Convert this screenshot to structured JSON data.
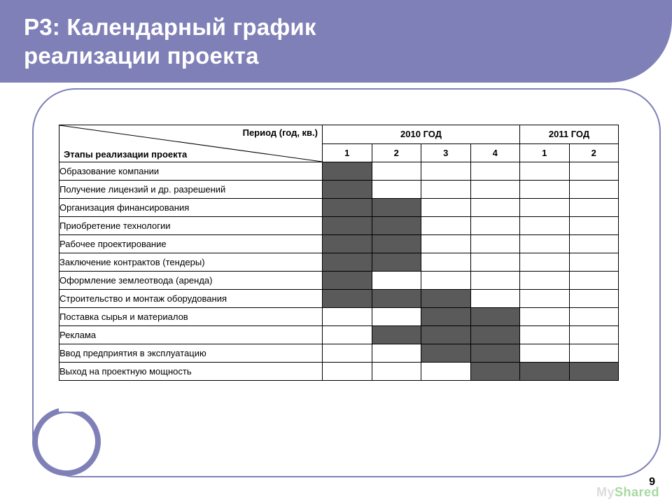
{
  "header": {
    "title_line1": "Р3: Календарный график",
    "title_line2": "реализации проекта"
  },
  "table": {
    "period_label": "Период (год, кв.)",
    "stages_label": "Этапы реализации проекта",
    "year_groups": [
      {
        "label": "2010 ГОД",
        "quarters": [
          "1",
          "2",
          "3",
          "4"
        ]
      },
      {
        "label": "2011 ГОД",
        "quarters": [
          "1",
          "2"
        ]
      }
    ],
    "rows": [
      {
        "stage": "Образование компании",
        "cells": [
          1,
          0,
          0,
          0,
          0,
          0
        ]
      },
      {
        "stage": "Получение лицензий и др. разрешений",
        "cells": [
          1,
          0,
          0,
          0,
          0,
          0
        ]
      },
      {
        "stage": "Организация финансирования",
        "cells": [
          1,
          1,
          0,
          0,
          0,
          0
        ]
      },
      {
        "stage": "Приобретение технологии",
        "cells": [
          1,
          1,
          0,
          0,
          0,
          0
        ]
      },
      {
        "stage": "Рабочее проектирование",
        "cells": [
          1,
          1,
          0,
          0,
          0,
          0
        ]
      },
      {
        "stage": "Заключение контрактов (тендеры)",
        "cells": [
          1,
          1,
          0,
          0,
          0,
          0
        ]
      },
      {
        "stage": "Оформление землеотвода (аренда)",
        "cells": [
          1,
          0,
          0,
          0,
          0,
          0
        ]
      },
      {
        "stage": "Строительство и монтаж оборудования",
        "cells": [
          1,
          1,
          1,
          0,
          0,
          0
        ]
      },
      {
        "stage": "Поставка сырья и материалов",
        "cells": [
          0,
          0,
          1,
          1,
          0,
          0
        ]
      },
      {
        "stage": "Реклама",
        "cells": [
          0,
          1,
          1,
          1,
          0,
          0
        ]
      },
      {
        "stage": "Ввод предприятия в эксплуатацию",
        "cells": [
          0,
          0,
          1,
          1,
          0,
          0
        ]
      },
      {
        "stage": "Выход на проектную мощность",
        "cells": [
          0,
          0,
          0,
          1,
          1,
          1
        ]
      }
    ]
  },
  "page_number": "9",
  "watermark": {
    "brand_prefix": "My",
    "brand_suffix": "Shared"
  },
  "chart_data": {
    "type": "table",
    "title": "Р3: Календарный график реализации проекта",
    "columns_axis": "Период (год, кв.)",
    "rows_axis": "Этапы реализации проекта",
    "columns": [
      "2010 Q1",
      "2010 Q2",
      "2010 Q3",
      "2010 Q4",
      "2011 Q1",
      "2011 Q2"
    ],
    "rows": [
      "Образование компании",
      "Получение лицензий и др. разрешений",
      "Организация финансирования",
      "Приобретение технологии",
      "Рабочее проектирование",
      "Заключение контрактов (тендеры)",
      "Оформление землеотвода (аренда)",
      "Строительство и монтаж оборудования",
      "Поставка сырья и материалов",
      "Реклама",
      "Ввод предприятия в эксплуатацию",
      "Выход на проектную мощность"
    ],
    "matrix": [
      [
        1,
        0,
        0,
        0,
        0,
        0
      ],
      [
        1,
        0,
        0,
        0,
        0,
        0
      ],
      [
        1,
        1,
        0,
        0,
        0,
        0
      ],
      [
        1,
        1,
        0,
        0,
        0,
        0
      ],
      [
        1,
        1,
        0,
        0,
        0,
        0
      ],
      [
        1,
        1,
        0,
        0,
        0,
        0
      ],
      [
        1,
        0,
        0,
        0,
        0,
        0
      ],
      [
        1,
        1,
        1,
        0,
        0,
        0
      ],
      [
        0,
        0,
        1,
        1,
        0,
        0
      ],
      [
        0,
        1,
        1,
        1,
        0,
        0
      ],
      [
        0,
        0,
        1,
        1,
        0,
        0
      ],
      [
        0,
        0,
        0,
        1,
        1,
        1
      ]
    ]
  }
}
